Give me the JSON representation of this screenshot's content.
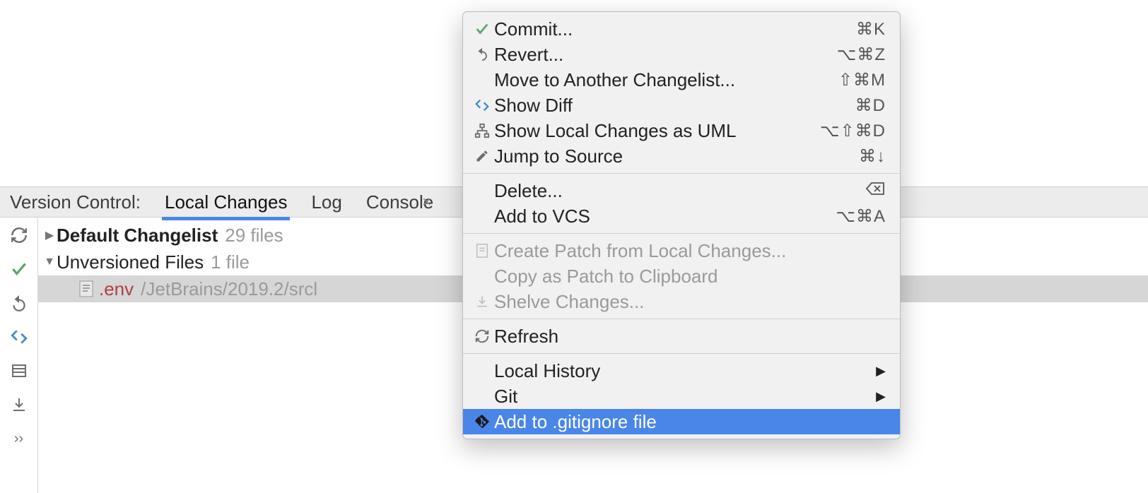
{
  "tabs": {
    "title": "Version Control:",
    "local_changes": "Local Changes",
    "log": "Log",
    "console": "Console"
  },
  "tree": {
    "default_changelist": "Default Changelist",
    "default_count": "29 files",
    "unversioned": "Unversioned Files",
    "unversioned_count": "1 file",
    "file_name": ".env",
    "file_path": "/JetBrains/2019.2/srcl"
  },
  "menu": {
    "commit": "Commit...",
    "commit_sc": "⌘K",
    "revert": "Revert...",
    "revert_sc": "⌥⌘Z",
    "move": "Move to Another Changelist...",
    "move_sc": "⇧⌘M",
    "diff": "Show Diff",
    "diff_sc": "⌘D",
    "uml": "Show Local Changes as UML",
    "uml_sc": "⌥⇧⌘D",
    "jump": "Jump to Source",
    "jump_sc": "⌘↓",
    "delete": "Delete...",
    "delete_sc": "⌫",
    "addvcs": "Add to VCS",
    "addvcs_sc": "⌥⌘A",
    "createpatch": "Create Patch from Local Changes...",
    "copypatch": "Copy as Patch to Clipboard",
    "shelve": "Shelve Changes...",
    "refresh": "Refresh",
    "localhistory": "Local History",
    "git": "Git",
    "gitignore": "Add to .gitignore file"
  }
}
